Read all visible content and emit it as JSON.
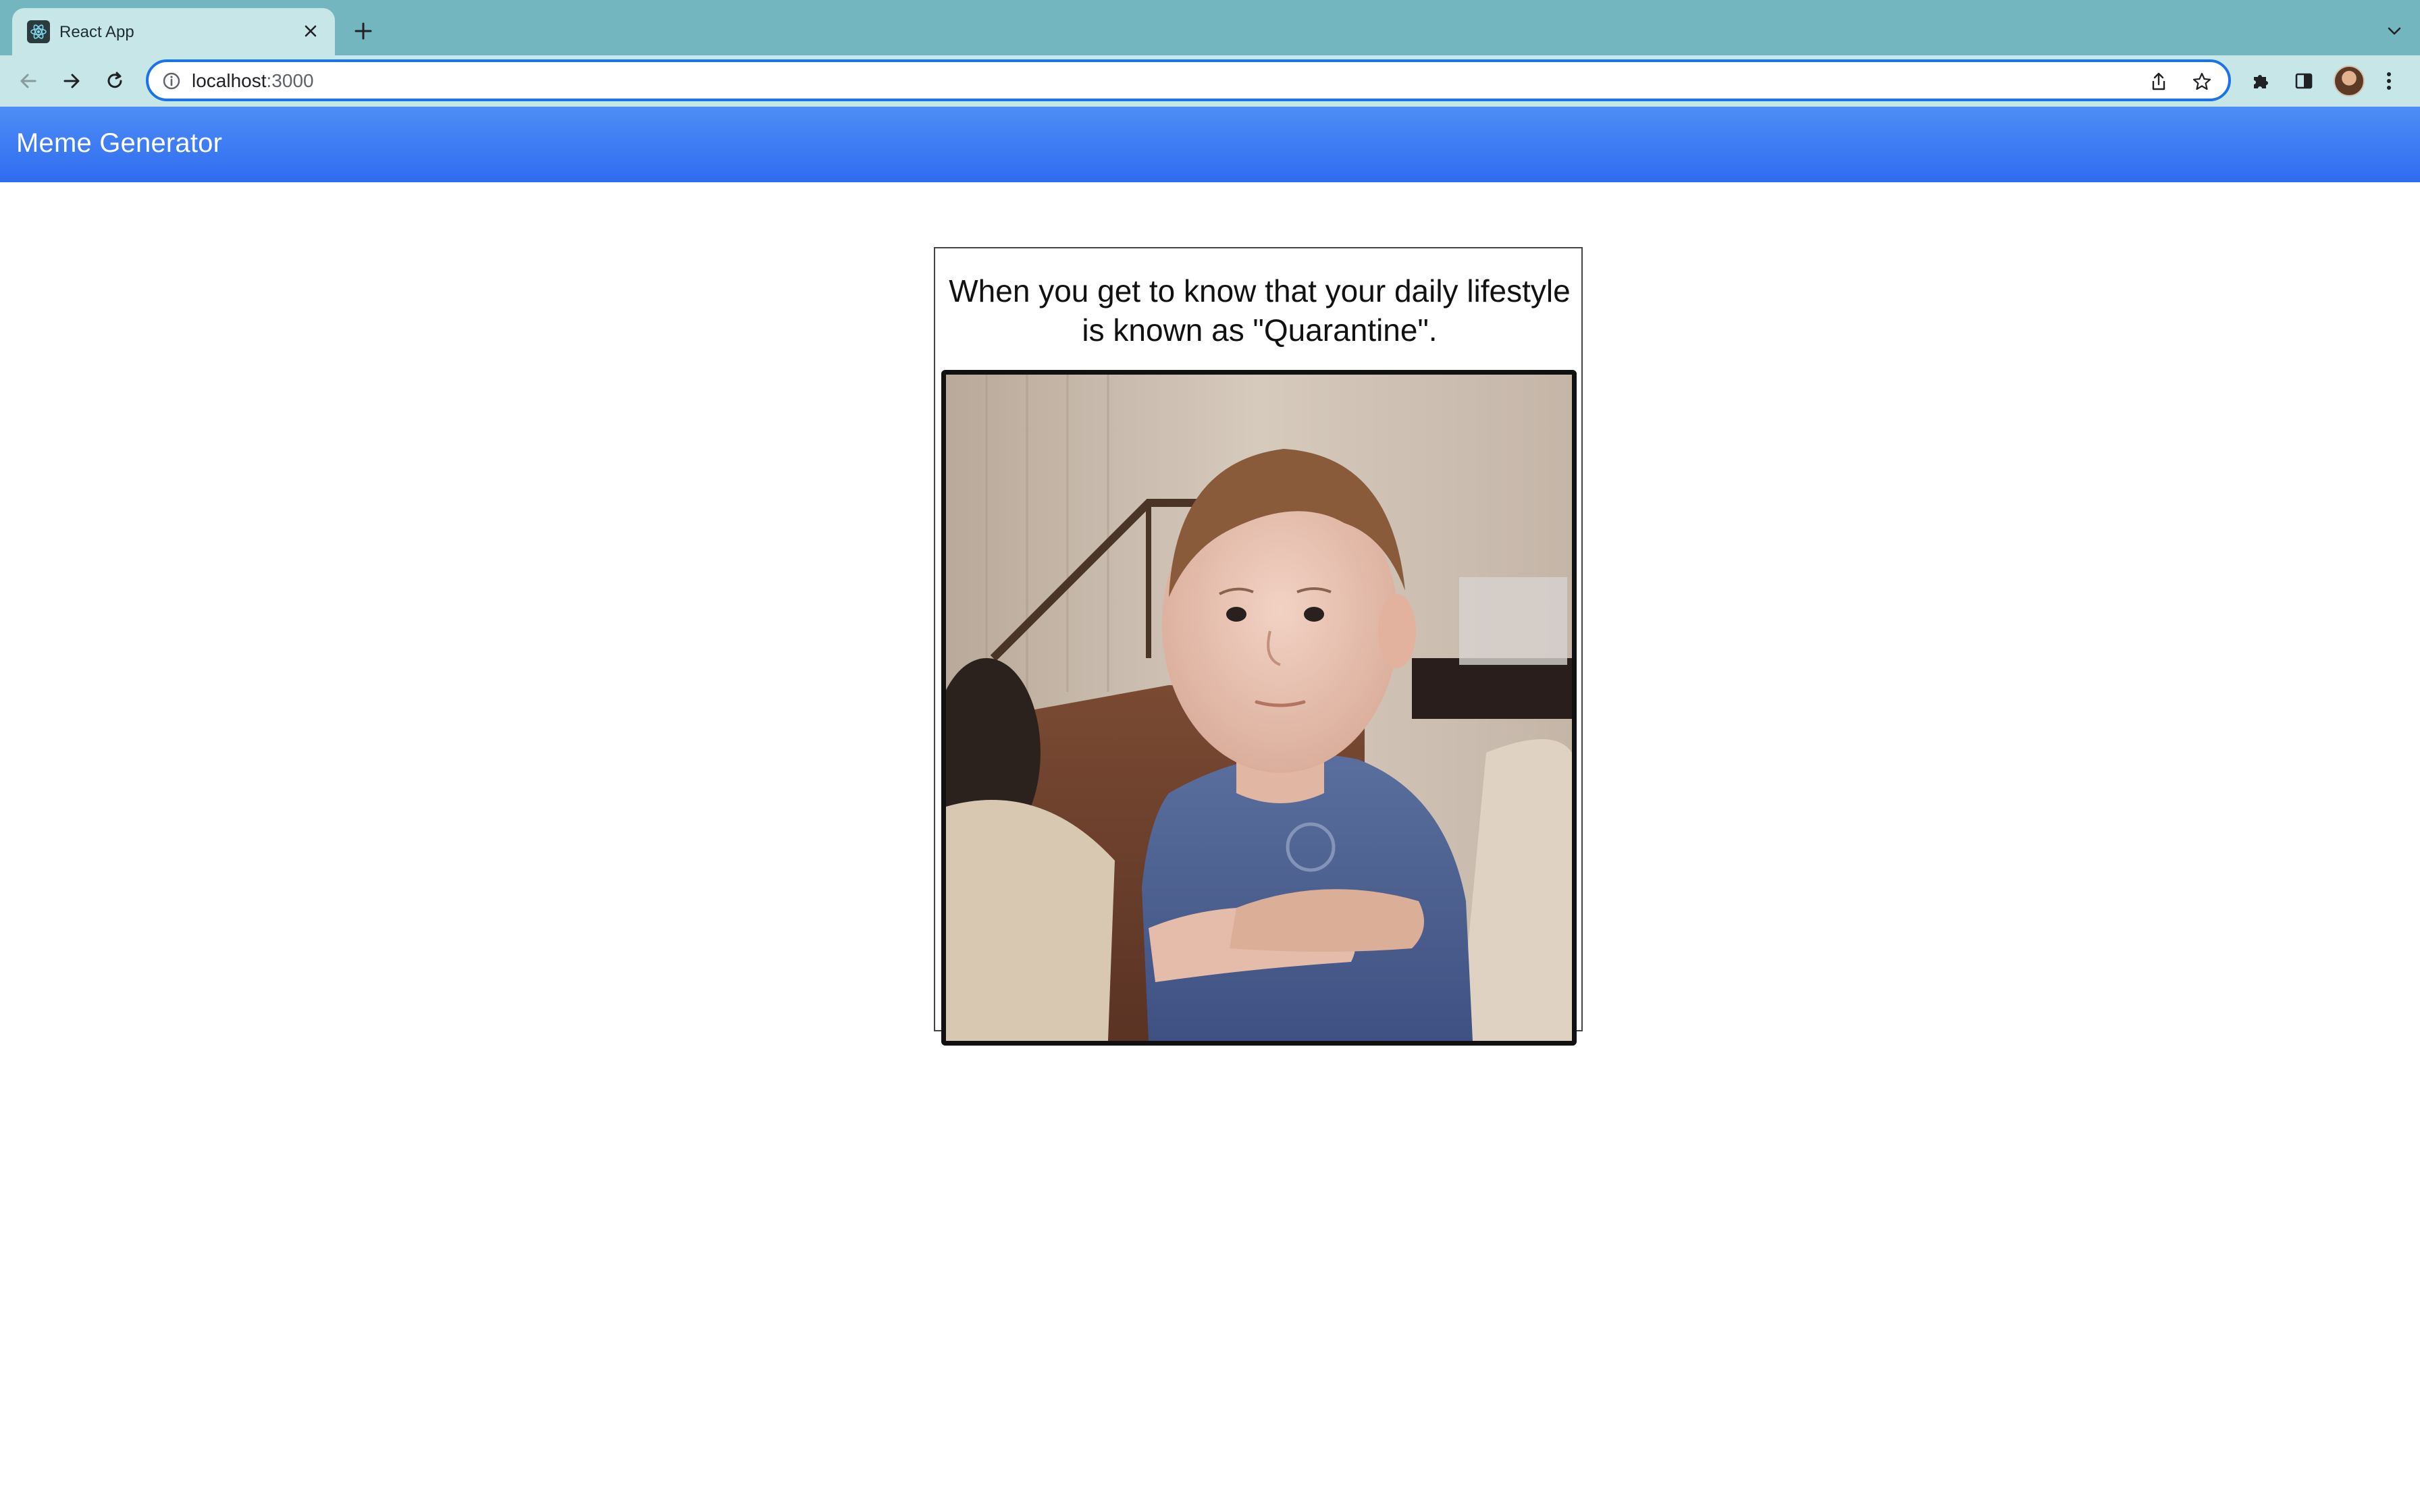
{
  "browser": {
    "tab": {
      "title": "React App"
    },
    "address": {
      "host": "localhost",
      "port": ":3000"
    }
  },
  "app": {
    "title": "Meme Generator",
    "meme": {
      "caption": "When you get to know that your daily lifestyle is known as \"Quarantine\".",
      "image_subject": "toddler-in-blue-shirt-arms-crossed"
    }
  },
  "colors": {
    "accent_blue": "#3b7cf4",
    "tab_strip": "#74b6bf",
    "toolbar": "#c6e6e8",
    "omnibox_border": "#1a73e8"
  }
}
